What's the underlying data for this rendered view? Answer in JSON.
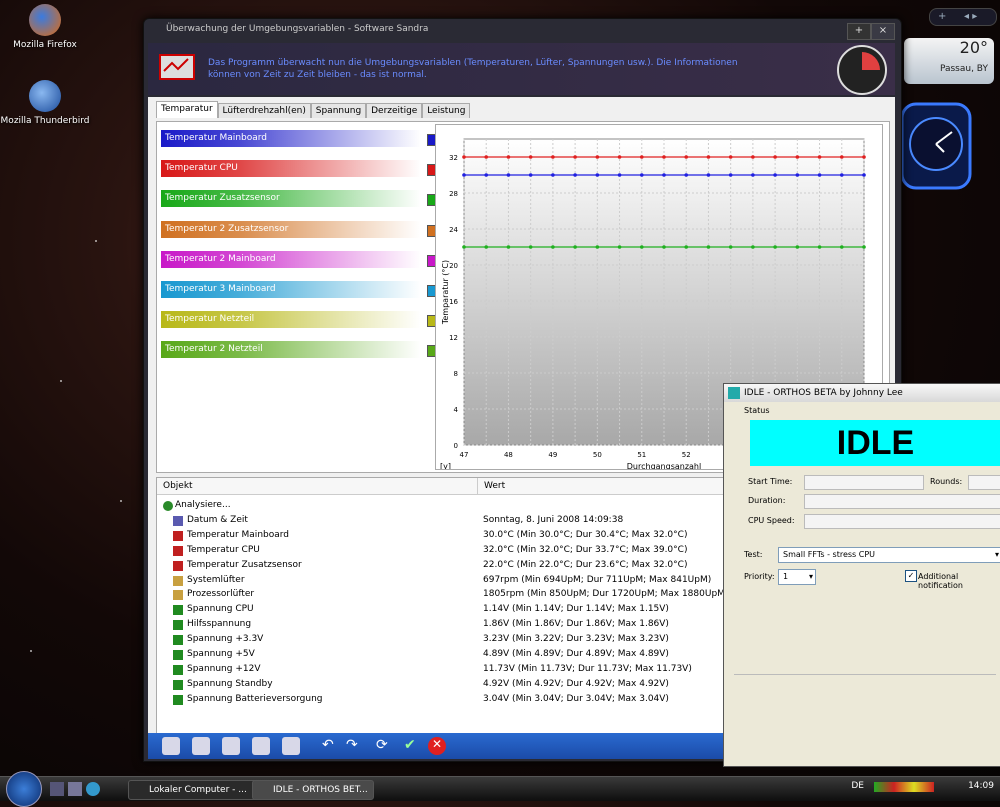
{
  "desktop": {
    "icons": [
      {
        "label": "Mozilla Firefox"
      },
      {
        "label": "Mozilla Thunderbird"
      }
    ]
  },
  "gadgets": {
    "weather": {
      "temp": "20°",
      "location": "Passau, BY"
    },
    "gadget_bar": {
      "add": "+",
      "nav": "◂ ▸"
    }
  },
  "main_window": {
    "title": "Überwachung der Umgebungsvariablen - Software Sandra",
    "banner_text": "Das Programm überwacht nun die Umgebungsvariablen (Temperaturen, Lüfter, Spannungen usw.). Die Informationen können von Zeit zu Zeit bleiben - das ist normal.",
    "tabs": [
      "Temparatur",
      "Lüfterdrehzahl(en)",
      "Spannung",
      "Derzeitige",
      "Leistung"
    ],
    "sensors": [
      {
        "label": "Temperatur Mainboard",
        "color": "#1a1ac8"
      },
      {
        "label": "Temperatur CPU",
        "color": "#d81818"
      },
      {
        "label": "Temperatur Zusatzsensor",
        "color": "#18a818"
      },
      {
        "label": "Temperatur 2 Zusatzsensor",
        "color": "#d07020"
      },
      {
        "label": "Temperatur 2 Mainboard",
        "color": "#c818c8"
      },
      {
        "label": "Temperatur 3 Mainboard",
        "color": "#1898d0"
      },
      {
        "label": "Temperatur Netzteil",
        "color": "#b8b818"
      },
      {
        "label": "Temperatur 2 Netzteil",
        "color": "#58a818"
      }
    ],
    "list_headers": {
      "object": "Objekt",
      "value": "Wert"
    },
    "rows": [
      {
        "name": "Analysiere...",
        "value": ""
      },
      {
        "name": "Datum & Zeit",
        "value": "Sonntag, 8. Juni 2008 14:09:38"
      },
      {
        "name": "Temperatur Mainboard",
        "value": "30.0°C (Min 30.0°C; Dur 30.4°C; Max 32.0°C)"
      },
      {
        "name": "Temperatur CPU",
        "value": "32.0°C (Min 32.0°C; Dur 33.7°C; Max 39.0°C)"
      },
      {
        "name": "Temperatur Zusatzsensor",
        "value": "22.0°C (Min 22.0°C; Dur 23.6°C; Max 32.0°C)"
      },
      {
        "name": "Systemlüfter",
        "value": "697rpm (Min 694UpM; Dur 711UpM; Max 841UpM)"
      },
      {
        "name": "Prozessorlüfter",
        "value": "1805rpm (Min 850UpM; Dur 1720UpM; Max 1880UpM)"
      },
      {
        "name": "Spannung CPU",
        "value": "1.14V (Min 1.14V; Dur 1.14V; Max 1.15V)"
      },
      {
        "name": "Hilfsspannung",
        "value": "1.86V (Min 1.86V; Dur 1.86V; Max 1.86V)"
      },
      {
        "name": "Spannung +3.3V",
        "value": "3.23V (Min 3.22V; Dur 3.23V; Max 3.23V)"
      },
      {
        "name": "Spannung +5V",
        "value": "4.89V (Min 4.89V; Dur 4.89V; Max 4.89V)"
      },
      {
        "name": "Spannung +12V",
        "value": "11.73V (Min 11.73V; Dur 11.73V; Max 11.73V)"
      },
      {
        "name": "Spannung Standby",
        "value": "4.92V (Min 4.92V; Dur 4.92V; Max 4.92V)"
      },
      {
        "name": "Spannung Batterieversorgung",
        "value": "3.04V (Min 3.04V; Dur 3.04V; Max 3.04V)"
      }
    ]
  },
  "chart_data": {
    "type": "line",
    "xlabel": "Durchgangsanzahl",
    "ylabel": "Temparatur (°C)",
    "corner_label": "[y]",
    "x": [
      47,
      48,
      49,
      50,
      51,
      52
    ],
    "x_ticks": [
      "47",
      "48",
      "49",
      "50",
      "51",
      "52"
    ],
    "ylim": [
      0,
      34
    ],
    "y_ticks": [
      "0",
      "4",
      "8",
      "12",
      "16",
      "20",
      "24",
      "28",
      "32"
    ],
    "y_tick_values": [
      0,
      4,
      8,
      12,
      16,
      20,
      24,
      28,
      32
    ],
    "grid": true,
    "series": [
      {
        "color": "#e02020",
        "value": 32
      },
      {
        "color": "#2020e0",
        "value": 30
      },
      {
        "color": "#20b020",
        "value": 22
      }
    ]
  },
  "orthos": {
    "title": "IDLE - ORTHOS BETA by Johnny Lee",
    "status_label": "Status",
    "status_text": "IDLE",
    "start_time_label": "Start Time:",
    "rounds_label": "Rounds:",
    "duration_label": "Duration:",
    "cpu_speed_label": "CPU Speed:",
    "test_label": "Test:",
    "test_value": "Small FFTs - stress CPU",
    "priority_label": "Priority:",
    "priority_value": "1",
    "notification_label": "Additional notification"
  },
  "taskbar": {
    "tasks": [
      {
        "label": "Lokaler Computer - ..."
      },
      {
        "label": "IDLE - ORTHOS BET..."
      }
    ],
    "lang": "DE",
    "time": "14:09"
  }
}
